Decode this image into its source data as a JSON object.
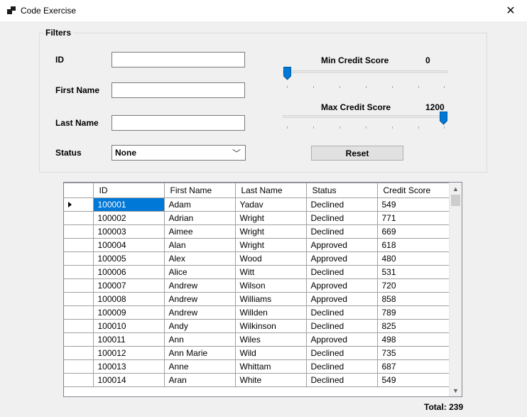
{
  "window": {
    "title": "Code Exercise"
  },
  "filters": {
    "group_label": "Filters",
    "id_label": "ID",
    "id_value": "",
    "first_name_label": "First Name",
    "first_name_value": "",
    "last_name_label": "Last Name",
    "last_name_value": "",
    "status_label": "Status",
    "status_selected": "None",
    "min_credit_label": "Min Credit Score",
    "min_credit_value": "0",
    "max_credit_label": "Max Credit Score",
    "max_credit_value": "1200",
    "reset_label": "Reset"
  },
  "grid": {
    "columns": [
      "ID",
      "First Name",
      "Last Name",
      "Status",
      "Credit Score"
    ],
    "rows": [
      [
        "100001",
        "Adam",
        "Yadav",
        "Declined",
        "549"
      ],
      [
        "100002",
        "Adrian",
        "Wright",
        "Declined",
        "771"
      ],
      [
        "100003",
        "Aimee",
        "Wright",
        "Declined",
        "669"
      ],
      [
        "100004",
        "Alan",
        "Wright",
        "Approved",
        "618"
      ],
      [
        "100005",
        "Alex",
        "Wood",
        "Approved",
        "480"
      ],
      [
        "100006",
        "Alice",
        "Witt",
        "Declined",
        "531"
      ],
      [
        "100007",
        "Andrew",
        "Wilson",
        "Approved",
        "720"
      ],
      [
        "100008",
        "Andrew",
        "Williams",
        "Approved",
        "858"
      ],
      [
        "100009",
        "Andrew",
        "Willden",
        "Declined",
        "789"
      ],
      [
        "100010",
        "Andy",
        "Wilkinson",
        "Declined",
        "825"
      ],
      [
        "100011",
        "Ann",
        "Wiles",
        "Approved",
        "498"
      ],
      [
        "100012",
        "Ann Marie",
        "Wild",
        "Declined",
        "735"
      ],
      [
        "100013",
        "Anne",
        "Whittam",
        "Declined",
        "687"
      ],
      [
        "100014",
        "Aran",
        "White",
        "Declined",
        "549"
      ]
    ]
  },
  "total_label": "Total: 239",
  "colors": {
    "accent": "#0078d7",
    "selection": "#0078d7"
  }
}
